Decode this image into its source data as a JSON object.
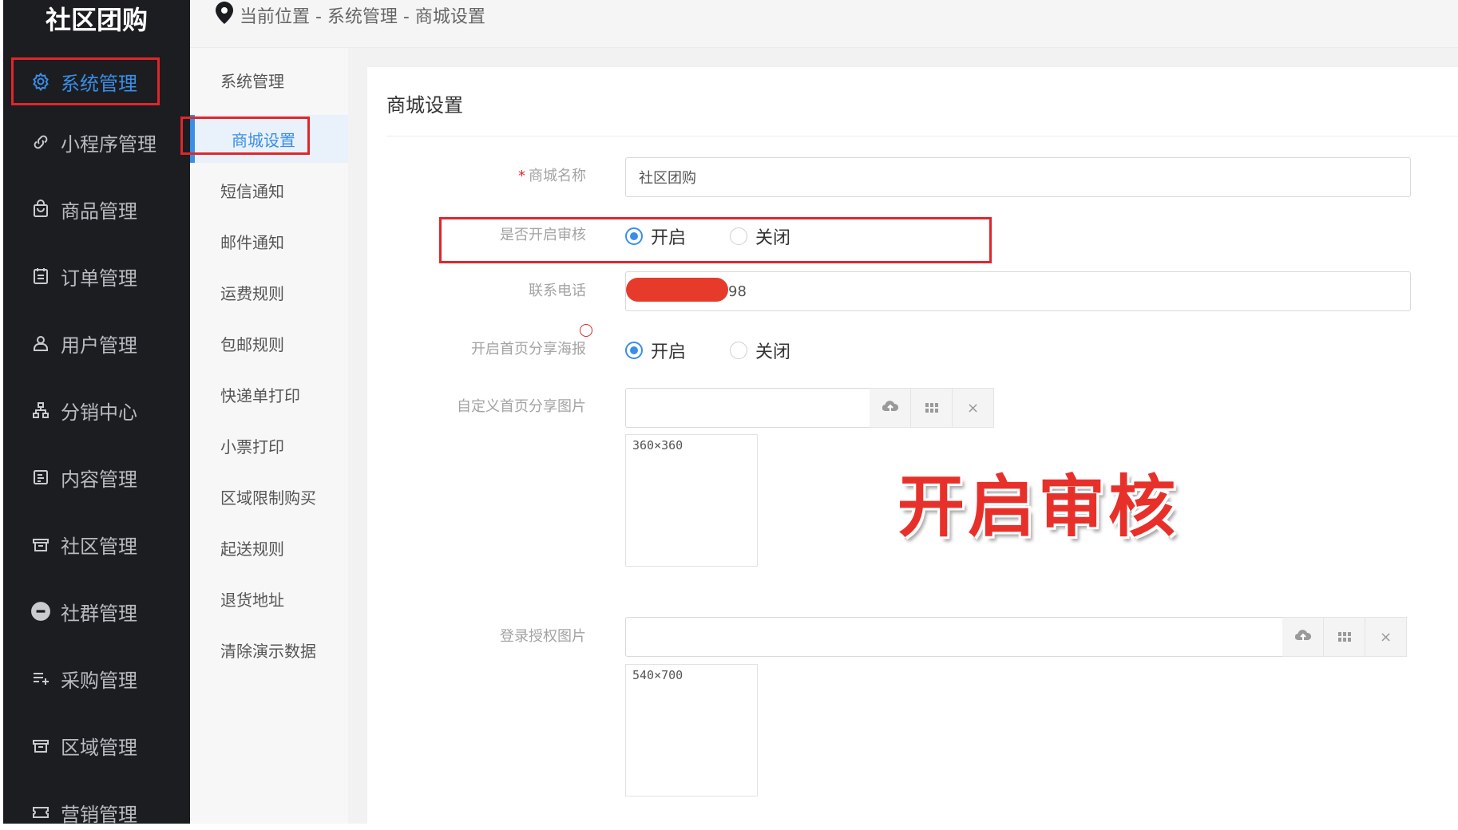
{
  "brand": "社区团购",
  "sidebar": {
    "items": [
      {
        "label": "系统管理",
        "icon": "gear-icon",
        "active": true
      },
      {
        "label": "小程序管理",
        "icon": "link-icon"
      },
      {
        "label": "商品管理",
        "icon": "shopping-bag-icon"
      },
      {
        "label": "订单管理",
        "icon": "calendar-list-icon"
      },
      {
        "label": "用户管理",
        "icon": "user-icon"
      },
      {
        "label": "分销中心",
        "icon": "hierarchy-icon"
      },
      {
        "label": "内容管理",
        "icon": "document-icon"
      },
      {
        "label": "社区管理",
        "icon": "store-icon"
      },
      {
        "label": "社群管理",
        "icon": "minus-circle-icon"
      },
      {
        "label": "采购管理",
        "icon": "list-add-icon"
      },
      {
        "label": "区域管理",
        "icon": "store-icon"
      },
      {
        "label": "营销管理",
        "icon": "coupon-icon"
      }
    ]
  },
  "breadcrumb": {
    "text": "当前位置 - 系统管理 - 商城设置",
    "icon": "location-pin-icon"
  },
  "submenu": {
    "items": [
      {
        "label": "系统管理"
      },
      {
        "label": "商城设置",
        "active": true
      },
      {
        "label": "短信通知"
      },
      {
        "label": "邮件通知"
      },
      {
        "label": "运费规则"
      },
      {
        "label": "包邮规则"
      },
      {
        "label": "快递单打印"
      },
      {
        "label": "小票打印"
      },
      {
        "label": "区域限制购买"
      },
      {
        "label": "起送规则"
      },
      {
        "label": "退货地址"
      },
      {
        "label": "清除演示数据"
      }
    ]
  },
  "panel": {
    "title": "商城设置"
  },
  "form": {
    "shop_name": {
      "label": "商城名称",
      "required_mark": "*",
      "value": "社区团购"
    },
    "audit": {
      "label": "是否开启审核",
      "option_on": "开启",
      "option_off": "关闭",
      "selected": "开启"
    },
    "phone": {
      "label": "联系电话",
      "value_visible_suffix": "98"
    },
    "share_poster": {
      "label": "开启首页分享海报",
      "option_on": "开启",
      "option_off": "关闭",
      "selected": "开启"
    },
    "share_image": {
      "label": "自定义首页分享图片",
      "size_hint": "360×360"
    },
    "login_image": {
      "label": "登录授权图片",
      "size_hint": "540×700"
    }
  },
  "upload_buttons": {
    "upload_icon": "cloud-upload-icon",
    "grid_icon": "grid-icon",
    "clear_icon": "close-icon",
    "clear_glyph": "×"
  },
  "overlay_caption": "开启审核",
  "colors": {
    "accent": "#3a8ee6",
    "highlight": "#e0262b",
    "sidebar_bg": "#1c1d21"
  }
}
